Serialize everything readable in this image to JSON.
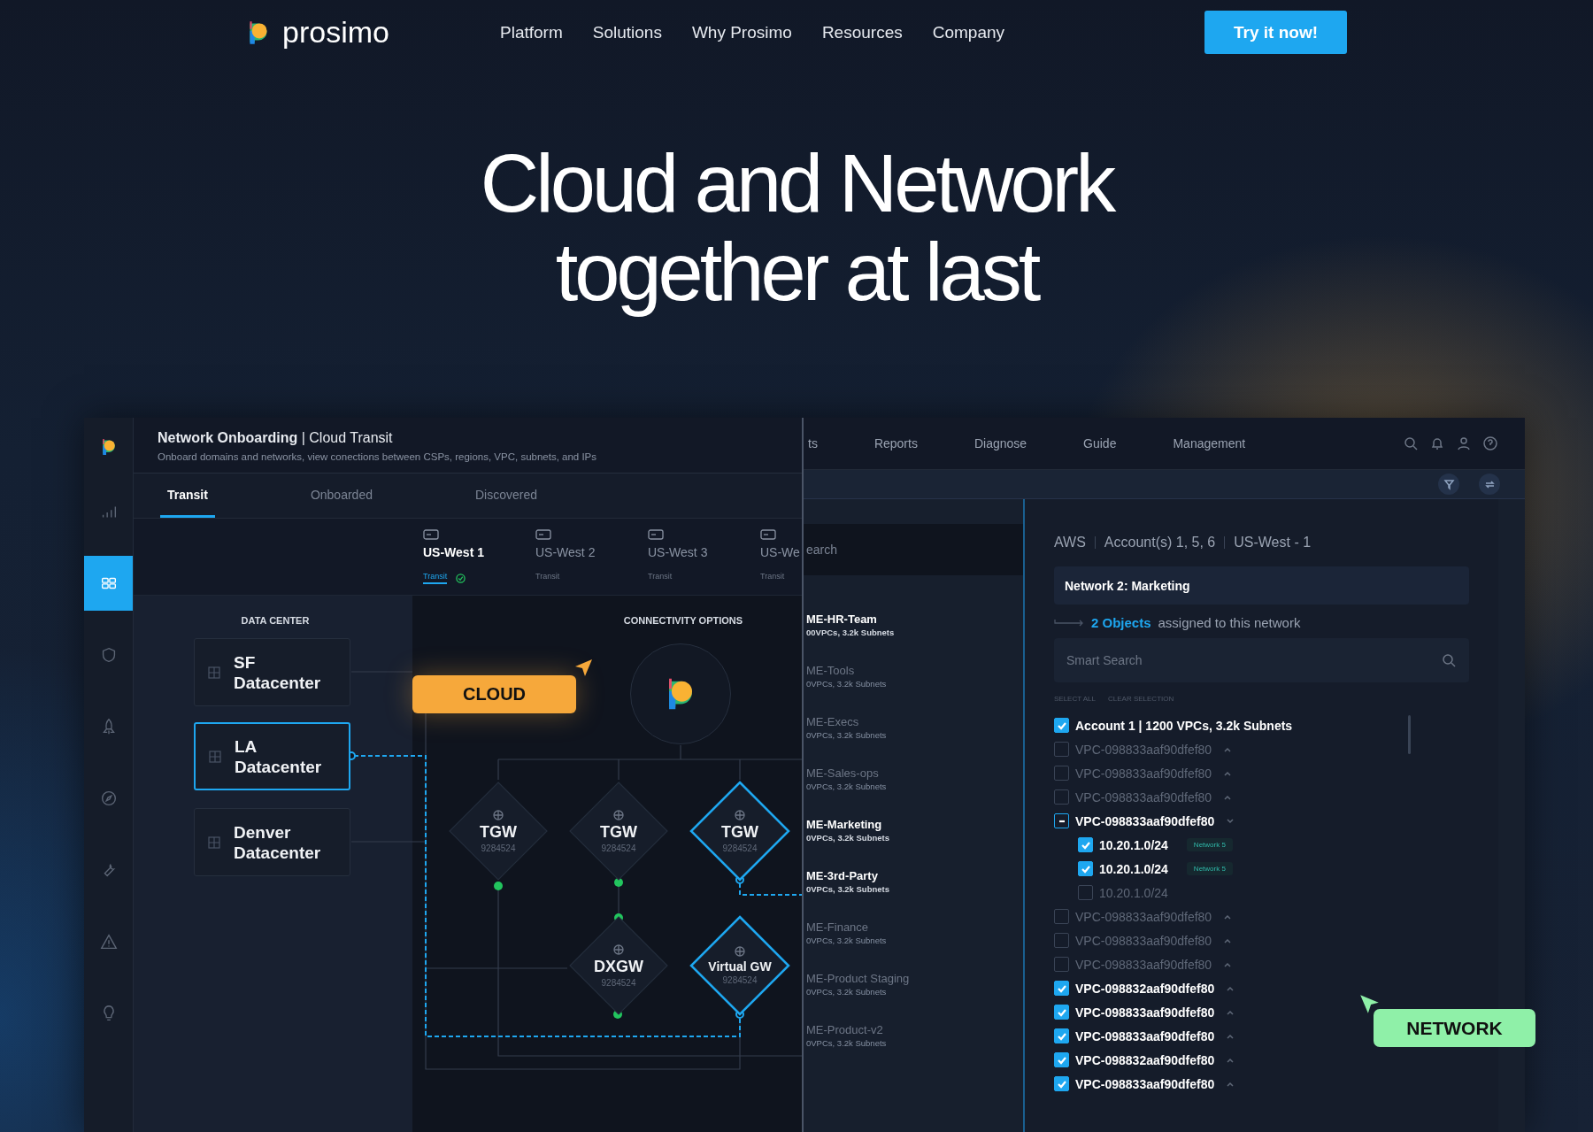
{
  "header": {
    "brand": "prosimo",
    "nav": [
      "Platform",
      "Solutions",
      "Why Prosimo",
      "Resources",
      "Company"
    ],
    "cta": "Try it now!"
  },
  "hero": {
    "lines": [
      "Cloud and Network",
      "together at last"
    ]
  },
  "app": {
    "sidebar": [
      {
        "selected": false
      },
      {
        "selected": true
      },
      {
        "selected": false
      },
      {
        "selected": false
      },
      {
        "selected": false
      },
      {
        "selected": false
      },
      {
        "selected": false
      },
      {
        "selected": false
      }
    ],
    "onboarding": {
      "title": "**Network Onboarding** | Cloud Transit",
      "subtitle": "Onboard domains and networks, view conections between CSPs, regions, VPC, subnets, and IPs",
      "tabs": [
        {
          "label": "Transit",
          "selected": true
        },
        {
          "label": "Onboarded",
          "selected": false
        },
        {
          "label": "Discovered",
          "selected": false
        }
      ],
      "regions": [
        {
          "name": "US-West 1",
          "status": "Transit",
          "selected": true,
          "verified": true
        },
        {
          "name": "US-West 2",
          "status": "Transit",
          "selected": false,
          "verified": false
        },
        {
          "name": "US-West 3",
          "status": "Transit",
          "selected": false,
          "verified": false
        },
        {
          "name": "US-We",
          "status": "Transit",
          "selected": false,
          "verified": false
        }
      ],
      "datacenter_heading": "DATA CENTER",
      "connectivity_heading": "CONNECTIVITY OPTIONS",
      "datacenters": [
        {
          "label": "SF Datacenter",
          "selected": false
        },
        {
          "label": "LA Datacenter",
          "selected": true
        },
        {
          "label": "Denver Datacenter",
          "selected": false
        }
      ],
      "cloud_tag": "CLOUD",
      "gateways": [
        {
          "label": "TGW",
          "number": "9284524",
          "highlighted": false
        },
        {
          "label": "TGW",
          "number": "9284524",
          "highlighted": false
        },
        {
          "label": "TGW",
          "number": "9284524",
          "highlighted": true
        },
        {
          "label": "DXGW",
          "number": "9284524",
          "highlighted": false
        },
        {
          "label": "Virtual GW",
          "number": "9284524",
          "highlighted": true
        }
      ]
    },
    "console": {
      "nav": [
        "ts",
        "Reports",
        "Diagnose",
        "Guide",
        "Management"
      ],
      "search_fragment": "earch",
      "networks": [
        {
          "name": "ME-HR-Team",
          "summary": "00VPCs, 3.2k Subnets",
          "active": true
        },
        {
          "name": "ME-Tools",
          "summary": "0VPCs, 3.2k Subnets",
          "active": false
        },
        {
          "name": "ME-Execs",
          "summary": "0VPCs, 3.2k Subnets",
          "active": false
        },
        {
          "name": "ME-Sales-ops",
          "summary": "0VPCs, 3.2k Subnets",
          "active": false
        },
        {
          "name": "ME-Marketing",
          "summary": "0VPCs, 3.2k Subnets",
          "active": true
        },
        {
          "name": "ME-3rd-Party",
          "summary": "0VPCs, 3.2k Subnets",
          "active": true
        },
        {
          "name": "ME-Finance",
          "summary": "0VPCs, 3.2k Subnets",
          "active": false
        },
        {
          "name": "ME-Product Staging",
          "summary": "0VPCs, 3.2k Subnets",
          "active": false
        },
        {
          "name": "ME-Product-v2",
          "summary": "0VPCs, 3.2k Subnets",
          "active": false
        }
      ]
    },
    "assignment": {
      "breadcrumb": [
        "AWS",
        "Account(s) 1, 5, 6",
        "US-West - 1"
      ],
      "network_name": "Network 2: Marketing",
      "objects_count": "2 Objects",
      "objects_text": "assigned to this network",
      "search": {
        "placeholder": "Smart Search"
      },
      "select_all": "SELECT ALL",
      "clear_selection": "CLEAR SELECTION",
      "tree": [
        {
          "kind": "account",
          "label": "Account 1  |  1200 VPCs, 3.2k Subnets",
          "checked": true,
          "indeterminate": false
        },
        {
          "kind": "vpc",
          "label": "VPC-098833aaf90dfef80",
          "checked": false,
          "indeterminate": false,
          "expanded": false
        },
        {
          "kind": "vpc",
          "label": "VPC-098833aaf90dfef80",
          "checked": false,
          "indeterminate": false,
          "expanded": false
        },
        {
          "kind": "vpc",
          "label": "VPC-098833aaf90dfef80",
          "checked": false,
          "indeterminate": false,
          "expanded": false
        },
        {
          "kind": "vpc",
          "label": "VPC-098833aaf90dfef80",
          "checked": false,
          "indeterminate": true,
          "expanded": true,
          "children": [
            {
              "kind": "subnet",
              "label": "10.20.1.0/24",
              "checked": true,
              "indeterminate": false,
              "tag": "Network 5"
            },
            {
              "kind": "subnet",
              "label": "10.20.1.0/24",
              "checked": true,
              "indeterminate": false,
              "tag": "Network 5"
            },
            {
              "kind": "subnet",
              "label": "10.20.1.0/24",
              "checked": false,
              "indeterminate": false
            }
          ]
        },
        {
          "kind": "vpc",
          "label": "VPC-098833aaf90dfef80",
          "checked": false,
          "indeterminate": false,
          "expanded": false
        },
        {
          "kind": "vpc",
          "label": "VPC-098833aaf90dfef80",
          "checked": false,
          "indeterminate": false,
          "expanded": false
        },
        {
          "kind": "vpc",
          "label": "VPC-098833aaf90dfef80",
          "checked": false,
          "indeterminate": false,
          "expanded": false
        },
        {
          "kind": "vpc",
          "label": "VPC-098832aaf90dfef80",
          "checked": true,
          "indeterminate": false,
          "expanded": false
        },
        {
          "kind": "vpc",
          "label": "VPC-098833aaf90dfef80",
          "checked": true,
          "indeterminate": false,
          "expanded": false
        },
        {
          "kind": "vpc",
          "label": "VPC-098833aaf90dfef80",
          "checked": true,
          "indeterminate": false,
          "expanded": false
        },
        {
          "kind": "vpc",
          "label": "VPC-098832aaf90dfef80",
          "checked": true,
          "indeterminate": false,
          "expanded": false
        },
        {
          "kind": "vpc",
          "label": "VPC-098833aaf90dfef80",
          "checked": true,
          "indeterminate": false,
          "expanded": false
        }
      ]
    },
    "network_tag": "NETWORK"
  }
}
